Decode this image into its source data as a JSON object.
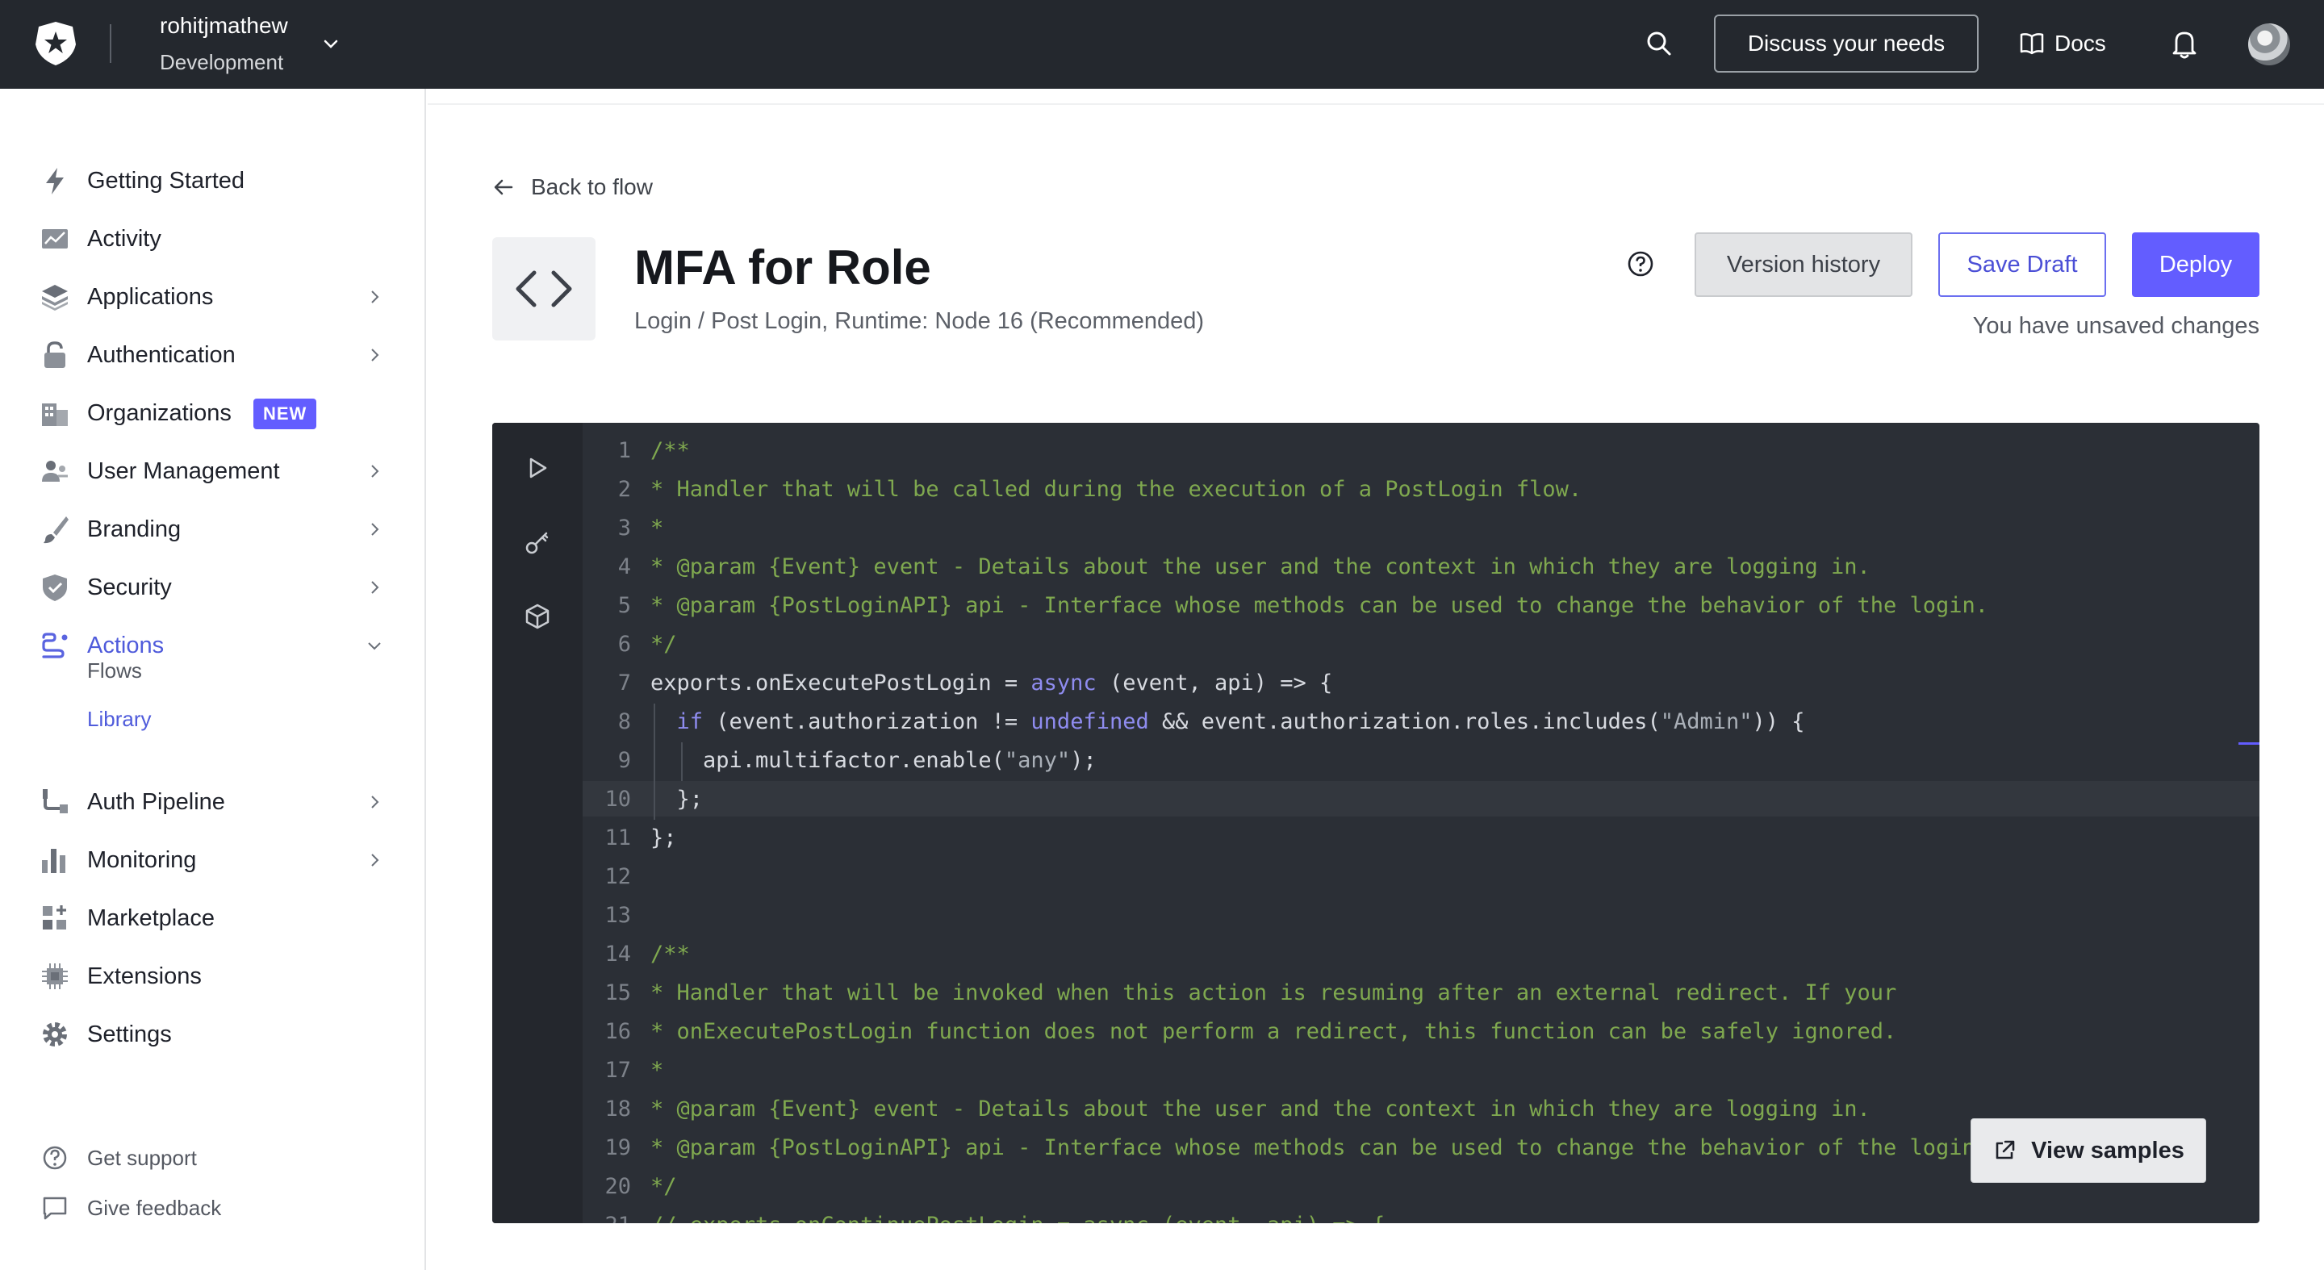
{
  "header": {
    "tenant_name": "rohitjmathew",
    "tenant_env": "Development",
    "discuss_label": "Discuss your needs",
    "docs_label": "Docs"
  },
  "sidebar": {
    "items": [
      {
        "label": "Getting Started",
        "icon": "lightning-icon"
      },
      {
        "label": "Activity",
        "icon": "activity-chart-icon"
      },
      {
        "label": "Applications",
        "icon": "layers-icon"
      },
      {
        "label": "Authentication",
        "icon": "lock-icon"
      },
      {
        "label": "Organizations",
        "icon": "building-icon",
        "badge": "NEW"
      },
      {
        "label": "User Management",
        "icon": "users-icon"
      },
      {
        "label": "Branding",
        "icon": "brush-icon"
      },
      {
        "label": "Security",
        "icon": "shield-icon"
      },
      {
        "label": "Actions",
        "icon": "actions-icon",
        "active": true
      },
      {
        "label": "Auth Pipeline",
        "icon": "pipeline-icon"
      },
      {
        "label": "Monitoring",
        "icon": "bar-chart-icon"
      },
      {
        "label": "Marketplace",
        "icon": "grid-plus-icon"
      },
      {
        "label": "Extensions",
        "icon": "chip-icon"
      },
      {
        "label": "Settings",
        "icon": "gear-icon"
      }
    ],
    "sub_items": [
      "Flows",
      "Library"
    ],
    "footer": [
      "Get support",
      "Give feedback"
    ]
  },
  "main": {
    "back_label": "Back to flow",
    "title": "MFA for Role",
    "subtitle": "Login / Post Login, Runtime: Node 16 (Recommended)",
    "version_history_label": "Version history",
    "save_draft_label": "Save Draft",
    "deploy_label": "Deploy",
    "unsaved_notice": "You have unsaved changes",
    "view_samples_label": "View samples"
  },
  "code_lines": [
    "/**",
    "* Handler that will be called during the execution of a PostLogin flow.",
    "*",
    "* @param {Event} event - Details about the user and the context in which they are logging in.",
    "* @param {PostLoginAPI} api - Interface whose methods can be used to change the behavior of the login.",
    "*/",
    "exports.onExecutePostLogin = async (event, api) => {",
    "  if (event.authorization != undefined && event.authorization.roles.includes(\"Admin\")) {",
    "    api.multifactor.enable(\"any\");",
    "  };",
    "};",
    "",
    "",
    "/**",
    "* Handler that will be invoked when this action is resuming after an external redirect. If your",
    "* onExecutePostLogin function does not perform a redirect, this function can be safely ignored.",
    "*",
    "* @param {Event} event - Details about the user and the context in which they are logging in.",
    "* @param {PostLoginAPI} api - Interface whose methods can be used to change the behavior of the login.",
    "*/",
    "// exports.onContinuePostLogin = async (event, api) => {",
    "// };"
  ]
}
